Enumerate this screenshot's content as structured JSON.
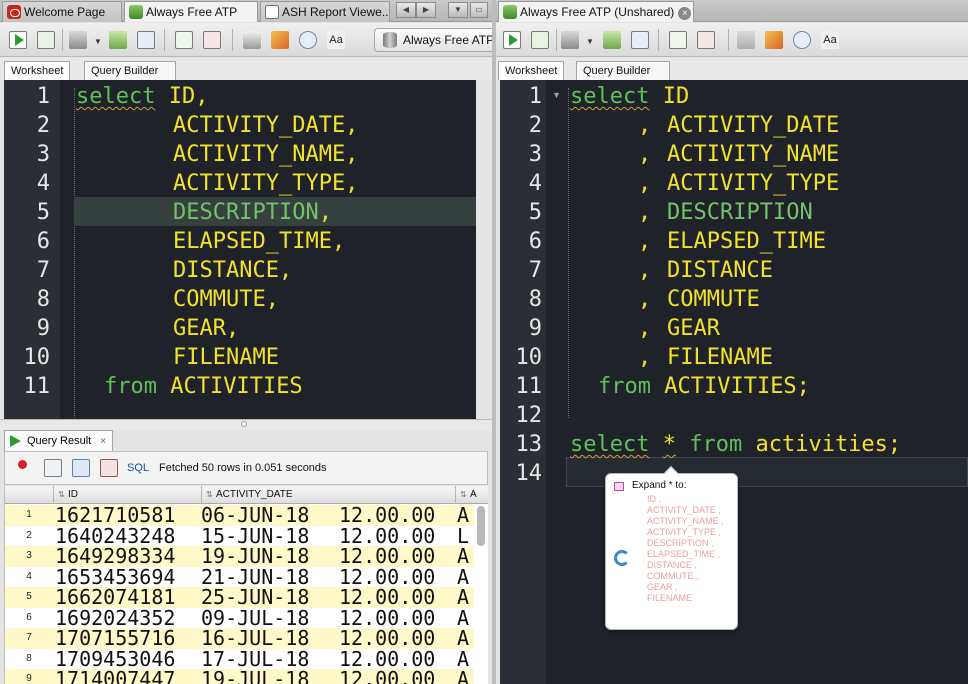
{
  "left": {
    "tabs": [
      {
        "label": "Welcome Page"
      },
      {
        "label": "Always Free ATP"
      },
      {
        "label": "ASH Report Viewe..."
      }
    ],
    "connection_label": "Always Free ATP",
    "subtabs": [
      "Worksheet",
      "Query Builder"
    ],
    "line_numbers": [
      "1",
      "2",
      "3",
      "4",
      "5",
      "6",
      "7",
      "8",
      "9",
      "10",
      "11"
    ],
    "code": {
      "l1_kw": "select",
      "l1_rest": " ID,",
      "l2": "ACTIVITY_DATE,",
      "l3": "ACTIVITY_NAME,",
      "l4": "ACTIVITY_TYPE,",
      "l5": "DESCRIPTION",
      "l5_comma": ",",
      "l6": "ELAPSED_TIME,",
      "l7": "DISTANCE,",
      "l8": "COMMUTE,",
      "l9": "GEAR,",
      "l10": "FILENAME",
      "l11_kw": "from",
      "l11_rest": " ACTIVITIES"
    },
    "result": {
      "tab_label": "Query Result",
      "close": "×",
      "sql_label": "SQL",
      "status": "Fetched 50 rows in 0.051 seconds",
      "columns": [
        "ID",
        "ACTIVITY_DATE",
        "A"
      ],
      "rows": [
        {
          "n": "1",
          "id": "1621710581",
          "date": "06-JUN-18",
          "time": "12.00.00",
          "a": "A"
        },
        {
          "n": "2",
          "id": "1640243248",
          "date": "15-JUN-18",
          "time": "12.00.00",
          "a": "L"
        },
        {
          "n": "3",
          "id": "1649298334",
          "date": "19-JUN-18",
          "time": "12.00.00",
          "a": "A"
        },
        {
          "n": "4",
          "id": "1653453694",
          "date": "21-JUN-18",
          "time": "12.00.00",
          "a": "A"
        },
        {
          "n": "5",
          "id": "1662074181",
          "date": "25-JUN-18",
          "time": "12.00.00",
          "a": "A"
        },
        {
          "n": "6",
          "id": "1692024352",
          "date": "09-JUL-18",
          "time": "12.00.00",
          "a": "A"
        },
        {
          "n": "7",
          "id": "1707155716",
          "date": "16-JUL-18",
          "time": "12.00.00",
          "a": "A"
        },
        {
          "n": "8",
          "id": "1709453046",
          "date": "17-JUL-18",
          "time": "12.00.00",
          "a": "A"
        },
        {
          "n": "9",
          "id": "1714007447",
          "date": "19-JUL-18",
          "time": "12.00.00",
          "a": "A"
        }
      ]
    }
  },
  "right": {
    "tab_label": "Always Free ATP (Unshared)",
    "subtabs": [
      "Worksheet",
      "Query Builder"
    ],
    "line_numbers": [
      "1",
      "2",
      "3",
      "4",
      "5",
      "6",
      "7",
      "8",
      "9",
      "10",
      "11",
      "12",
      "13",
      "14"
    ],
    "code": {
      "l1_kw": "select",
      "l1_rest": " ID",
      "l2": "ACTIVITY_DATE",
      "l3": "ACTIVITY_NAME",
      "l4": "ACTIVITY_TYPE",
      "l5": "DESCRIPTION",
      "l6": "ELAPSED_TIME",
      "l7": "DISTANCE",
      "l8": "COMMUTE",
      "l9": "GEAR",
      "l10": "FILENAME",
      "comma": ",",
      "l11_kw": "from",
      "l11_rest": " ACTIVITIES;",
      "l13_kw1": "select",
      "l13_star": "*",
      "l13_kw2": "from",
      "l13_rest": "activities;"
    },
    "popup": {
      "title": "Expand * to:",
      "columns": "ID ,\nACTIVITY_DATE ,\nACTIVITY_NAME ,\nACTIVITY_TYPE ,\nDESCRIPTION ,\nELAPSED_TIME ,\nDISTANCE ,\nCOMMUTE ,\nGEAR ,\nFILENAME"
    }
  },
  "colors": {
    "editor_bg": "#1f2329",
    "keyword": "#5fc15a",
    "identifier": "#f2e22b",
    "row_alt": "#fff8c8"
  }
}
